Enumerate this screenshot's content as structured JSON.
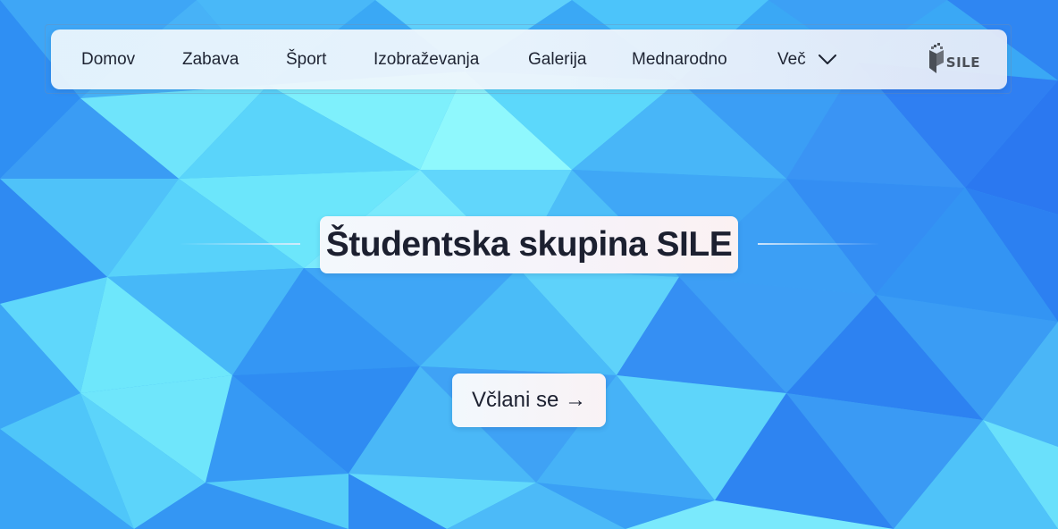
{
  "nav": {
    "items": [
      {
        "label": "Domov"
      },
      {
        "label": "Zabava"
      },
      {
        "label": "Šport"
      },
      {
        "label": "Izobraževanja"
      },
      {
        "label": "Galerija"
      },
      {
        "label": "Mednarodno"
      }
    ],
    "more_label": "Več",
    "more_icon": "chevron-down-icon",
    "logo_text": "SILE"
  },
  "hero": {
    "title": "Študentska skupina SILE",
    "cta_label": "Včlani se →"
  },
  "colors": {
    "background_accent": "#3aa8f5",
    "background_light": "#7cf2fb",
    "background_dark": "#2f7ff2",
    "text": "#1e2433",
    "logo": "#4a4f57"
  }
}
